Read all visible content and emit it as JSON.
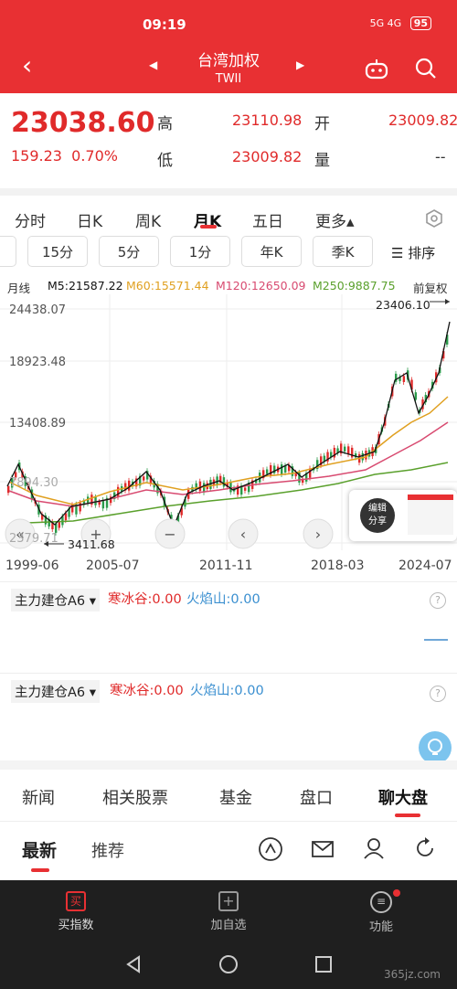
{
  "status": {
    "time": "09:19",
    "battery": "95",
    "signal": "5G 4G"
  },
  "header": {
    "title": "台湾加权",
    "subtitle": "TWII"
  },
  "quote": {
    "price": "23038.60",
    "change": "159.23",
    "change_pct": "0.70%",
    "high_label": "高",
    "high": "23110.98",
    "open_label": "开",
    "open": "23009.82",
    "low_label": "低",
    "low": "23009.82",
    "vol_label": "量",
    "vol": "--"
  },
  "period_tabs": [
    "分时",
    "日K",
    "周K",
    "月K",
    "五日",
    "更多▴"
  ],
  "sub_tabs": [
    "15分",
    "5分",
    "1分",
    "年K",
    "季K"
  ],
  "sort_label": "☰ 排序",
  "ma": {
    "type": "月线",
    "m5": "M5:21587.22",
    "m60": "M60:15571.44",
    "m120": "M120:12650.09",
    "m250": "M250:9887.75",
    "adjust": "前复权"
  },
  "colors": {
    "brand": "#e83033",
    "ma5": "#111111",
    "ma60": "#e0a020",
    "ma120": "#d84a70",
    "ma250": "#5aa02c"
  },
  "chart": {
    "y_ticks": [
      "24438.07",
      "18923.48",
      "13408.89",
      "7894.30",
      "2379.71"
    ],
    "max_label": "23406.10",
    "min_label": "3411.68",
    "x_ticks": [
      "1999-06",
      "2005-07",
      "2011-11",
      "2018-03",
      "2024-07"
    ],
    "share_label": "编辑\n分享"
  },
  "indicators": [
    {
      "name": "主力建仓A6",
      "a": "寒冰谷:0.00",
      "b": "火焰山:0.00"
    },
    {
      "name": "主力建仓A6",
      "a": "寒冰谷:0.00",
      "b": "火焰山:0.00"
    }
  ],
  "news_tabs": [
    "新闻",
    "相关股票",
    "基金",
    "盘口",
    "聊大盘"
  ],
  "feed_tabs": [
    "最新",
    "推荐"
  ],
  "bottom_nav": [
    "买指数",
    "加自选",
    "功能"
  ],
  "watermark": "365jz.com"
}
